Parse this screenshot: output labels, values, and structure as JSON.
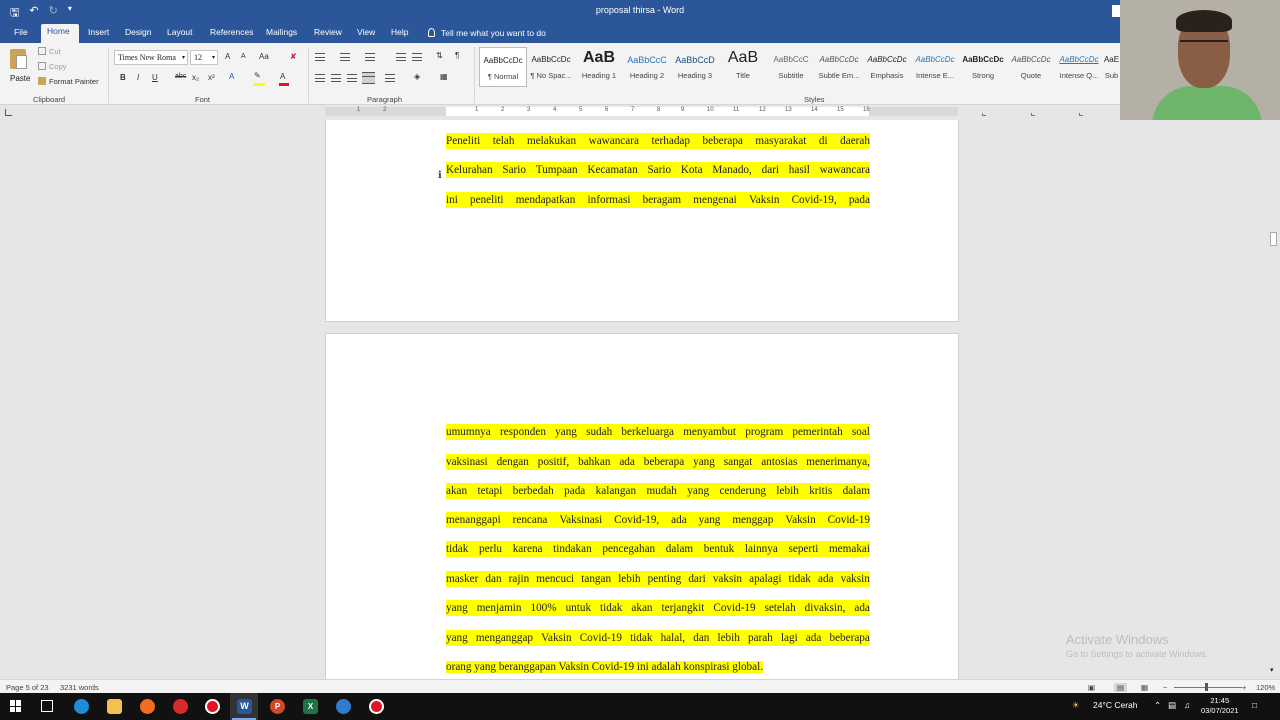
{
  "titlebar": {
    "title": "proposal thirsa  -  Word",
    "qat": {
      "save_icon": "save-icon",
      "undo_icon": "undo-icon",
      "redo_icon": "redo-icon"
    }
  },
  "menu_tabs": [
    {
      "label": "File"
    },
    {
      "label": "Home"
    },
    {
      "label": "Insert"
    },
    {
      "label": "Design"
    },
    {
      "label": "Layout"
    },
    {
      "label": "References"
    },
    {
      "label": "Mailings"
    },
    {
      "label": "Review"
    },
    {
      "label": "View"
    },
    {
      "label": "Help"
    }
  ],
  "tell_me": "Tell me what you want to do",
  "clipboard": {
    "paste": "Paste",
    "cut": "Cut",
    "copy": "Copy",
    "format_painter": "Format Painter",
    "group": "Clipboard"
  },
  "font": {
    "name": "Times New Roma",
    "size": "12",
    "grow": "A",
    "shrink": "A",
    "case": "Aa",
    "bold": "B",
    "italic": "I",
    "underline": "U",
    "strike": "abc",
    "subscript": "x₂",
    "superscript": "x²",
    "group": "Font",
    "highlight_color": "#ffff00",
    "font_color": "#e81123"
  },
  "paragraph": {
    "pilcrow": "¶",
    "group": "Paragraph"
  },
  "styles": {
    "group": "Styles",
    "items": [
      {
        "sample": "AaBbCcDc",
        "name": "¶ Normal"
      },
      {
        "sample": "AaBbCcDc",
        "name": "¶ No Spac..."
      },
      {
        "sample": "AaB",
        "name": "Heading 1"
      },
      {
        "sample": "AaBbCcC",
        "name": "Heading 2"
      },
      {
        "sample": "AaBbCcD",
        "name": "Heading 3"
      },
      {
        "sample": "AaB",
        "name": "Title"
      },
      {
        "sample": "AaBbCcC",
        "name": "Subtitle"
      },
      {
        "sample": "AaBbCcDc",
        "name": "Subtle Em..."
      },
      {
        "sample": "AaBbCcDc",
        "name": "Emphasis"
      },
      {
        "sample": "AaBbCcDc",
        "name": "Intense E..."
      },
      {
        "sample": "AaBbCcDc",
        "name": "Strong"
      },
      {
        "sample": "AaBbCcDc",
        "name": "Quote"
      },
      {
        "sample": "AaBbCcDc",
        "name": "Intense Q..."
      },
      {
        "sample": "AaE",
        "name": "Sub"
      }
    ]
  },
  "ruler": {
    "numbers": [
      "1",
      "2",
      "1",
      "2",
      "3",
      "4",
      "5",
      "6",
      "7",
      "8",
      "9",
      "10",
      "11",
      "12",
      "13",
      "14",
      "15",
      "16"
    ]
  },
  "document": {
    "highlight": "#ffff00",
    "page1": [
      [
        "Peneliti",
        "telah",
        "melakukan",
        "wawancara",
        "terhadap",
        "beberapa",
        "masyarakat",
        "di",
        "daerah"
      ],
      [
        "Kelurahan",
        "Sario",
        "Tumpaan",
        "Kecamatan",
        "Sario",
        "Kota",
        "Manado,",
        "dari",
        "hasil",
        "wawancara"
      ],
      [
        "ini",
        "peneliti",
        "mendapatkan",
        "informasi",
        "beragam",
        "mengenai",
        "Vaksin",
        "Covid-19,",
        "pada"
      ]
    ],
    "page2": [
      [
        "umumnya",
        "responden",
        "yang",
        "sudah",
        "berkeluarga",
        "menyambut",
        "program",
        "pemerintah",
        "soal"
      ],
      [
        "vaksinasi",
        "dengan",
        "positif,",
        "bahkan",
        "ada",
        "beberapa",
        "yang",
        "sangat",
        "antosias",
        "menerimanya,"
      ],
      [
        "akan",
        "tetapi",
        "berbedah",
        "pada",
        "kalangan",
        "mudah",
        "yang",
        "cenderung",
        "lebih",
        "kritis",
        "dalam"
      ],
      [
        "menanggapi",
        "rencana",
        "Vaksinasi",
        "Covid-19,",
        "ada",
        "yang",
        "menggap",
        "Vaksin",
        "Covid-19"
      ],
      [
        "tidak",
        "perlu",
        "karena",
        "tindakan",
        "pencegahan",
        "dalam",
        "bentuk",
        "lainnya",
        "seperti",
        "memakai"
      ],
      [
        "masker",
        "dan",
        "rajin",
        "mencuci",
        "tangan",
        "lebih",
        "penting",
        "dari",
        "vaksin",
        "apalagi",
        "tidak",
        "ada",
        "vaksin"
      ],
      [
        "yang",
        "menjamin",
        "100%",
        "untuk",
        "tidak",
        "akan",
        "terjangkit",
        "Covid-19",
        "setelah",
        "divaksin,",
        "ada"
      ],
      [
        "yang",
        "menganggap",
        "Vaksin",
        "Covid-19",
        "tidak",
        "halal,",
        "dan",
        "lebih",
        "parah",
        "lagi",
        "ada",
        "beberapa"
      ]
    ],
    "page2_last": "orang yang beranggapan Vaksin Covid-19 ini adalah konspirasi global."
  },
  "status": {
    "page": "Page 5 of 23",
    "words": "3231 words",
    "zoom": "120%"
  },
  "activate": {
    "title": "Activate Windows",
    "subtitle": "Go to Settings to activate Windows."
  },
  "taskbar": {
    "weather": "24°C  Cerah",
    "time": "21:45",
    "date": "03/07/2021",
    "apps": [
      {
        "name": "edge",
        "color": "#1b8fd6"
      },
      {
        "name": "file-explorer",
        "color": "#f2c14e"
      },
      {
        "name": "firefox",
        "color": "#f26b22"
      },
      {
        "name": "app-red-1",
        "color": "#d92b2b"
      },
      {
        "name": "app-red-2",
        "color": "#e81123"
      },
      {
        "name": "word",
        "color": "#2b579a"
      },
      {
        "name": "powerpoint",
        "color": "#d24726"
      },
      {
        "name": "excel",
        "color": "#217346"
      },
      {
        "name": "app-blue",
        "color": "#2e7bcf"
      },
      {
        "name": "recorder",
        "color": "#e81123"
      }
    ]
  }
}
